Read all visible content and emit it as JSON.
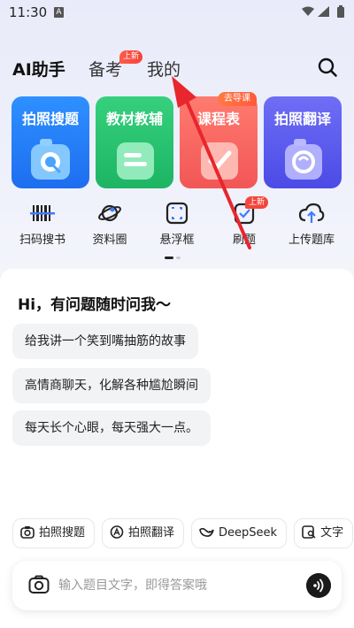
{
  "status": {
    "time": "11:30",
    "app_indicator": "A"
  },
  "header": {
    "tabs": [
      {
        "label": "AI助手"
      },
      {
        "label": "备考"
      },
      {
        "label": "我的"
      }
    ],
    "beikao_badge": "上新"
  },
  "cards": [
    {
      "label": "拍照搜题",
      "color_top": "#2b8bff",
      "color_bottom": "#1f6ff0"
    },
    {
      "label": "教材教辅",
      "color_top": "#33cf7a",
      "color_bottom": "#1fb866"
    },
    {
      "label": "课程表",
      "color_top": "#ff7a6e",
      "color_bottom": "#f55a55"
    },
    {
      "label": "拍照翻译",
      "color_top": "#6a6af5",
      "color_bottom": "#4d4de8"
    }
  ],
  "card_badge": "去导课",
  "tools": [
    {
      "label": "扫码搜书",
      "icon": "barcode-icon"
    },
    {
      "label": "资料圈",
      "icon": "planet-icon"
    },
    {
      "label": "悬浮框",
      "icon": "scan-frame-icon"
    },
    {
      "label": "刷题",
      "icon": "practice-icon"
    },
    {
      "label": "上传题库",
      "icon": "cloud-upload-icon"
    }
  ],
  "tool_badge": "上新",
  "chat": {
    "greeting": "Hi，有问题随时问我～",
    "suggestions": [
      "给我讲一个笑到嘴抽筋的故事",
      "高情商聊天，化解各种尴尬瞬间",
      "每天长个心眼，每天强大一点。"
    ],
    "chips": [
      {
        "label": "拍照搜题",
        "icon": "camera-icon"
      },
      {
        "label": "拍照翻译",
        "icon": "translate-icon"
      },
      {
        "label": "DeepSeek",
        "icon": "deepseek-icon"
      },
      {
        "label": "文字",
        "icon": "document-search-icon"
      }
    ],
    "input_placeholder": "输入题目文字，即得答案哦"
  },
  "colors": {
    "accent": "#1f6ff0",
    "annotation_arrow": "#e8262d"
  }
}
